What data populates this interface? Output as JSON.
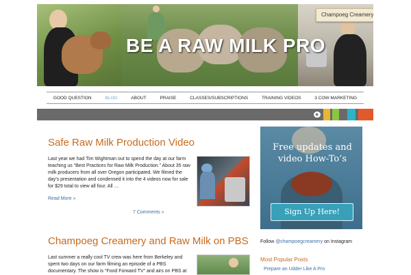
{
  "header": {
    "banner_title": "BE A RAW MILK PRO",
    "brand_badge": "Champoeg Creamery"
  },
  "nav": {
    "items": [
      {
        "label": "GOOD QUESTION"
      },
      {
        "label": "BLOG"
      },
      {
        "label": "ABOUT"
      },
      {
        "label": "PRAISE"
      },
      {
        "label": "CLASSES/SUBSCRIPTIONS"
      },
      {
        "label": "TRAINING VIDEOS"
      },
      {
        "label": "3 COW MARKETING"
      }
    ],
    "active_index": 1
  },
  "colorbar": {
    "swatches": [
      "#e9b533",
      "#8cc63f",
      "#2bb3c6",
      "#e25a2c"
    ],
    "rss_icon": "rss-icon"
  },
  "posts": [
    {
      "title": "Safe Raw Milk Production Video",
      "excerpt": "Last year we had Tim Wightman out to spend the day at our farm teaching us “Best Practices for Raw Milk Production.” About 35 raw milk producers from all over Oregon participated. We filmed the day’s presentation and condensed it into the 4 videos now for sale for $29 total to view all four. All …",
      "read_more": "Read More »",
      "comments": "7 Comments »"
    },
    {
      "title": "Champoeg Creamery and Raw Milk on PBS",
      "excerpt": "Last summer a really cool TV crew was here from Berkeley and spent two days on our farm filming an episode of a PBS documentary. The show is “Food Forward TV” and airs on PBS at"
    }
  ],
  "sidebar": {
    "promo_text": "Free updates and video How-To’s",
    "promo_button": "Sign Up Here!",
    "follow_prefix": "Follow ",
    "follow_handle": "@champoegcreamery",
    "follow_suffix": " on Instagram",
    "popular_heading": "Most Popular Posts",
    "popular_items": [
      "Prepare an Udder Like A Pro"
    ]
  }
}
